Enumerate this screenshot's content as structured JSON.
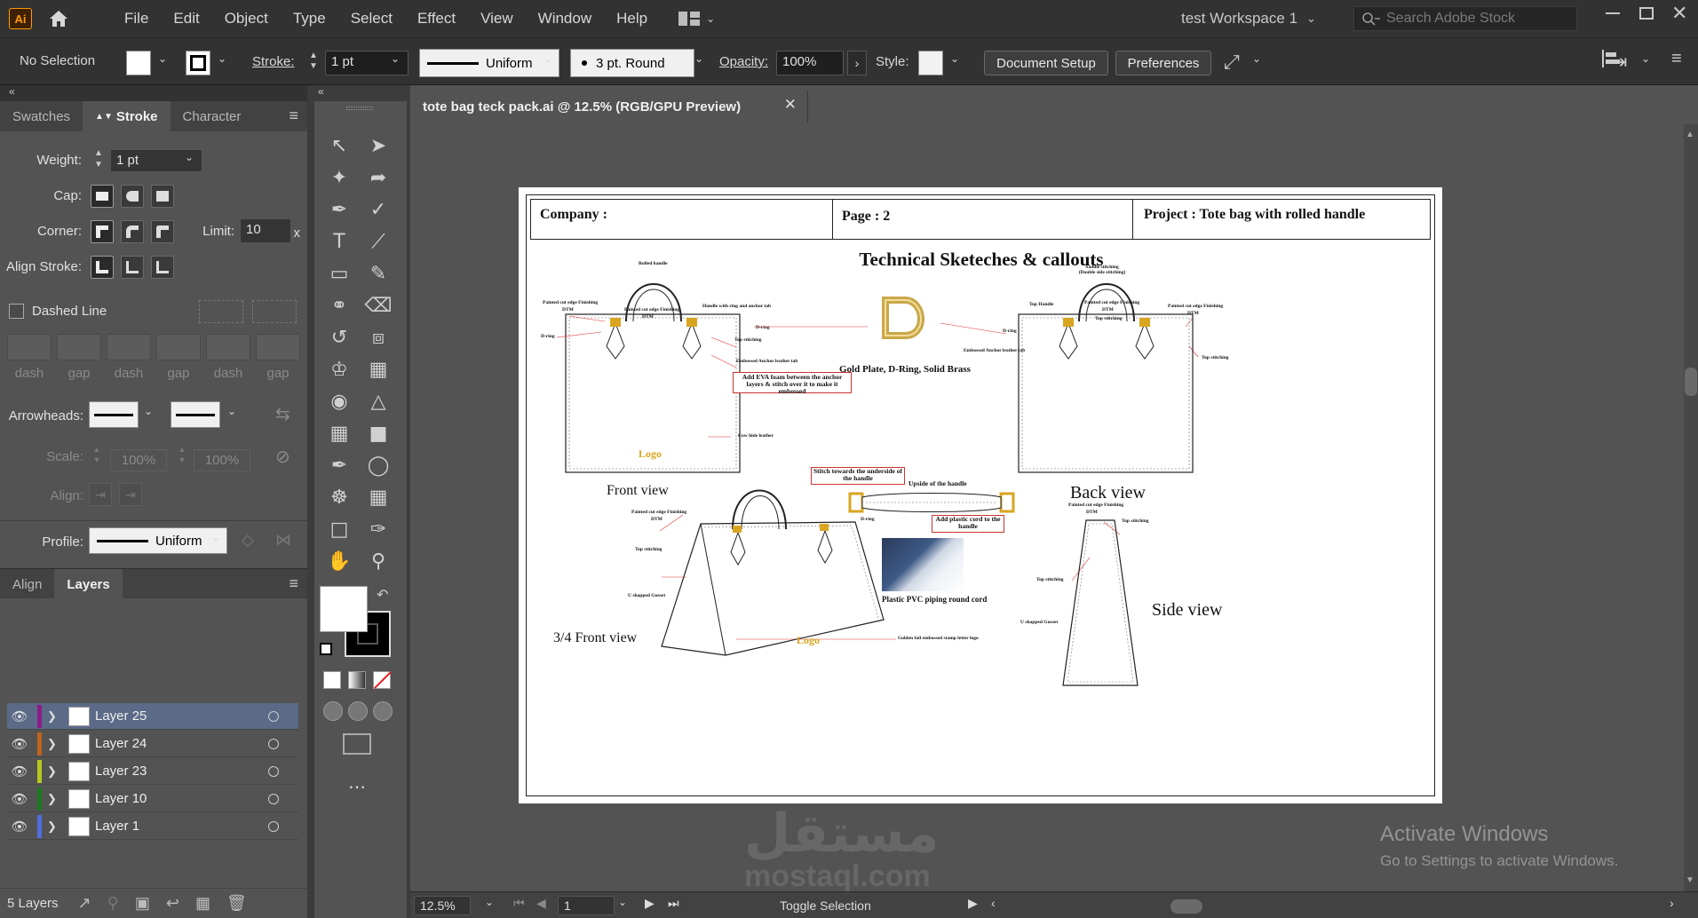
{
  "app": {
    "logo": "Ai",
    "workspace": "test Workspace 1",
    "search_placeholder": "Search Adobe Stock"
  },
  "menu": [
    "File",
    "Edit",
    "Object",
    "Type",
    "Select",
    "Effect",
    "View",
    "Window",
    "Help"
  ],
  "control": {
    "selection": "No Selection",
    "stroke_label": "Stroke:",
    "stroke_value": "1 pt",
    "profile": "Uniform",
    "brush": "3 pt. Round",
    "opacity_label": "Opacity:",
    "opacity_value": "100%",
    "style_label": "Style:",
    "document_setup": "Document Setup",
    "preferences": "Preferences"
  },
  "stroke_panel": {
    "tabs": [
      "Swatches",
      "Stroke",
      "Character"
    ],
    "weight_label": "Weight:",
    "weight_value": "1 pt",
    "cap_label": "Cap:",
    "corner_label": "Corner:",
    "limit_label": "Limit:",
    "limit_value": "10",
    "limit_unit": "x",
    "align_label": "Align Stroke:",
    "dashed_label": "Dashed Line",
    "dash_labels": [
      "dash",
      "gap",
      "dash",
      "gap",
      "dash",
      "gap"
    ],
    "arrowheads_label": "Arrowheads:",
    "scale_label": "Scale:",
    "scale_value1": "100%",
    "scale_value2": "100%",
    "align2_label": "Align:",
    "profile_label": "Profile:",
    "profile_value": "Uniform"
  },
  "layers_panel": {
    "tabs": [
      "Align",
      "Layers"
    ],
    "layers": [
      {
        "name": "Layer 25",
        "color": "#8a1c8a"
      },
      {
        "name": "Layer 24",
        "color": "#c0641e"
      },
      {
        "name": "Layer 23",
        "color": "#b5c91e"
      },
      {
        "name": "Layer 10",
        "color": "#1e7a1e"
      },
      {
        "name": "Layer 1",
        "color": "#4f6fe0"
      }
    ],
    "count": "5 Layers"
  },
  "document": {
    "tab_title": "tote bag teck pack.ai @ 12.5% (RGB/GPU Preview)",
    "header": {
      "company": "Company :",
      "page": "Page : 2",
      "project": "Project : Tote bag with rolled handle"
    },
    "title": "Technical Sketeches & callouts",
    "front_view": "Front view",
    "back_view": "Back view",
    "three_quarter_view": "3/4 Front view",
    "side_view": "Side view",
    "dring_caption": "Gold Plate, D-Ring, Solid Brass",
    "piping_caption": "Plastic  PVC piping  round cord",
    "logo_text": "Logo",
    "notes": {
      "rolled_handle": "Rolled handle",
      "painted_edge": "Painted cut edge Finishing",
      "dtm": "DTM",
      "handle_ring": "Handle with ring and anchor tab",
      "d_ring": "D-ring",
      "d_ring2": "D-ring",
      "top_stitching": "Top stitching",
      "embossed_tab": "Embossed Anchor  leather tab",
      "eva": "Add  EVA foam between the anchor layers & stitch over it to make it embossed",
      "cow_hide": "Cow hide leather",
      "saddle": "Saddle stitching (Double side stitching)",
      "top_handle": "Top Handle",
      "stitch_towards": "Stitch towards the underside of the handle",
      "upside_handle": "Upside of the handle",
      "plastic_cord": "Add plastic cord to the handle",
      "u_gusset": "U shapped Gusset",
      "golden_foil": "Golden foil embossed stamp letter logo"
    }
  },
  "status": {
    "zoom": "12.5%",
    "artboard": "1",
    "mode": "Toggle Selection"
  },
  "watermark": {
    "arabic": "مستقل",
    "latin": "mostaql.com"
  },
  "activate": {
    "title": "Activate Windows",
    "subtitle": "Go to Settings to activate Windows."
  }
}
